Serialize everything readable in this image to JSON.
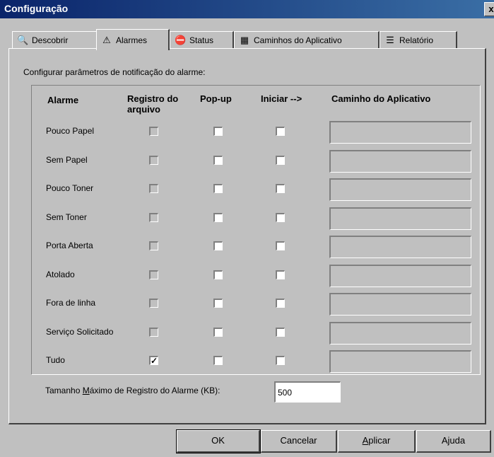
{
  "window": {
    "title": "Configuração",
    "close": "x"
  },
  "tabs": [
    {
      "label": "Descobrir",
      "icon": "discover-icon"
    },
    {
      "label": "Alarmes",
      "icon": "warning-icon"
    },
    {
      "label": "Status",
      "icon": "status-icon"
    },
    {
      "label": "Caminhos do Aplicativo",
      "icon": "app-path-icon"
    },
    {
      "label": "Relatório",
      "icon": "report-icon"
    }
  ],
  "caption": "Configurar parâmetros de notificação do alarme:",
  "headers": {
    "alarm": "Alarme",
    "log_line1": "Registro do",
    "log_line2": "arquivo",
    "popup": "Pop-up",
    "start": "Iniciar -->",
    "path": "Caminho do Aplicativo"
  },
  "rows": [
    {
      "label": "Pouco Papel",
      "log": false,
      "popup": false,
      "start": false,
      "path": ""
    },
    {
      "label": "Sem Papel",
      "log": false,
      "popup": false,
      "start": false,
      "path": ""
    },
    {
      "label": "Pouco Toner",
      "log": false,
      "popup": false,
      "start": false,
      "path": ""
    },
    {
      "label": "Sem Toner",
      "log": false,
      "popup": false,
      "start": false,
      "path": ""
    },
    {
      "label": "Porta Aberta",
      "log": false,
      "popup": false,
      "start": false,
      "path": ""
    },
    {
      "label": "Atolado",
      "log": false,
      "popup": false,
      "start": false,
      "path": ""
    },
    {
      "label": "Fora de linha",
      "log": false,
      "popup": false,
      "start": false,
      "path": ""
    },
    {
      "label": "Serviço Solicitado",
      "log": false,
      "popup": false,
      "start": false,
      "path": ""
    },
    {
      "label": "Tudo",
      "log": true,
      "popup": false,
      "start": false,
      "path": ""
    }
  ],
  "max_log": {
    "label_pre": "Tamanho ",
    "label_accel": "M",
    "label_post": "áximo de Registro do Alarme (KB):",
    "value": "500"
  },
  "buttons": {
    "ok": "OK",
    "cancel": "Cancelar",
    "apply_accel": "A",
    "apply_rest": "plicar",
    "help": "Ajuda"
  }
}
